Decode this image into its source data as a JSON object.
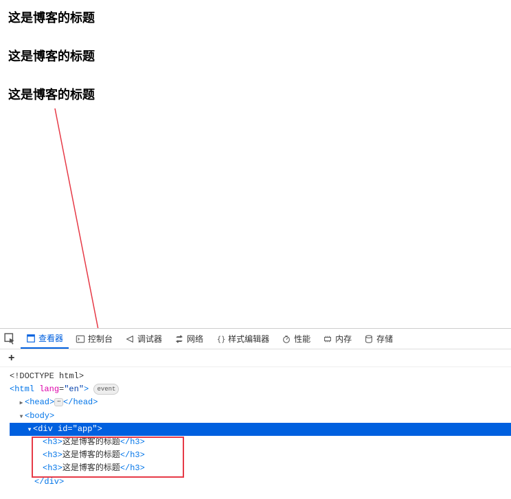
{
  "page": {
    "headings": [
      "这是博客的标题",
      "这是博客的标题",
      "这是博客的标题"
    ]
  },
  "devtools": {
    "tabs": {
      "inspector": "查看器",
      "console": "控制台",
      "debugger": "调试器",
      "network": "网络",
      "style_editor": "样式编辑器",
      "performance": "性能",
      "memory": "内存",
      "storage": "存储"
    },
    "dom": {
      "doctype": "<!DOCTYPE html>",
      "html_open": "<html",
      "html_lang_attr": "lang",
      "html_lang_val": "\"en\"",
      "html_close_bracket": ">",
      "event_badge": "event",
      "head_open": "<head>",
      "head_close": "</head>",
      "ellipsis": "⋯",
      "body_open": "<body>",
      "div_open": "<div",
      "div_id_attr": "id",
      "div_id_val": "\"app\"",
      "h3_open": "<h3>",
      "h3_close": "</h3>",
      "h3_text_1": "这是博客的标题",
      "h3_text_2": "这是博客的标题",
      "h3_text_3": "这是博客的标题",
      "div_close": "</div>"
    }
  }
}
